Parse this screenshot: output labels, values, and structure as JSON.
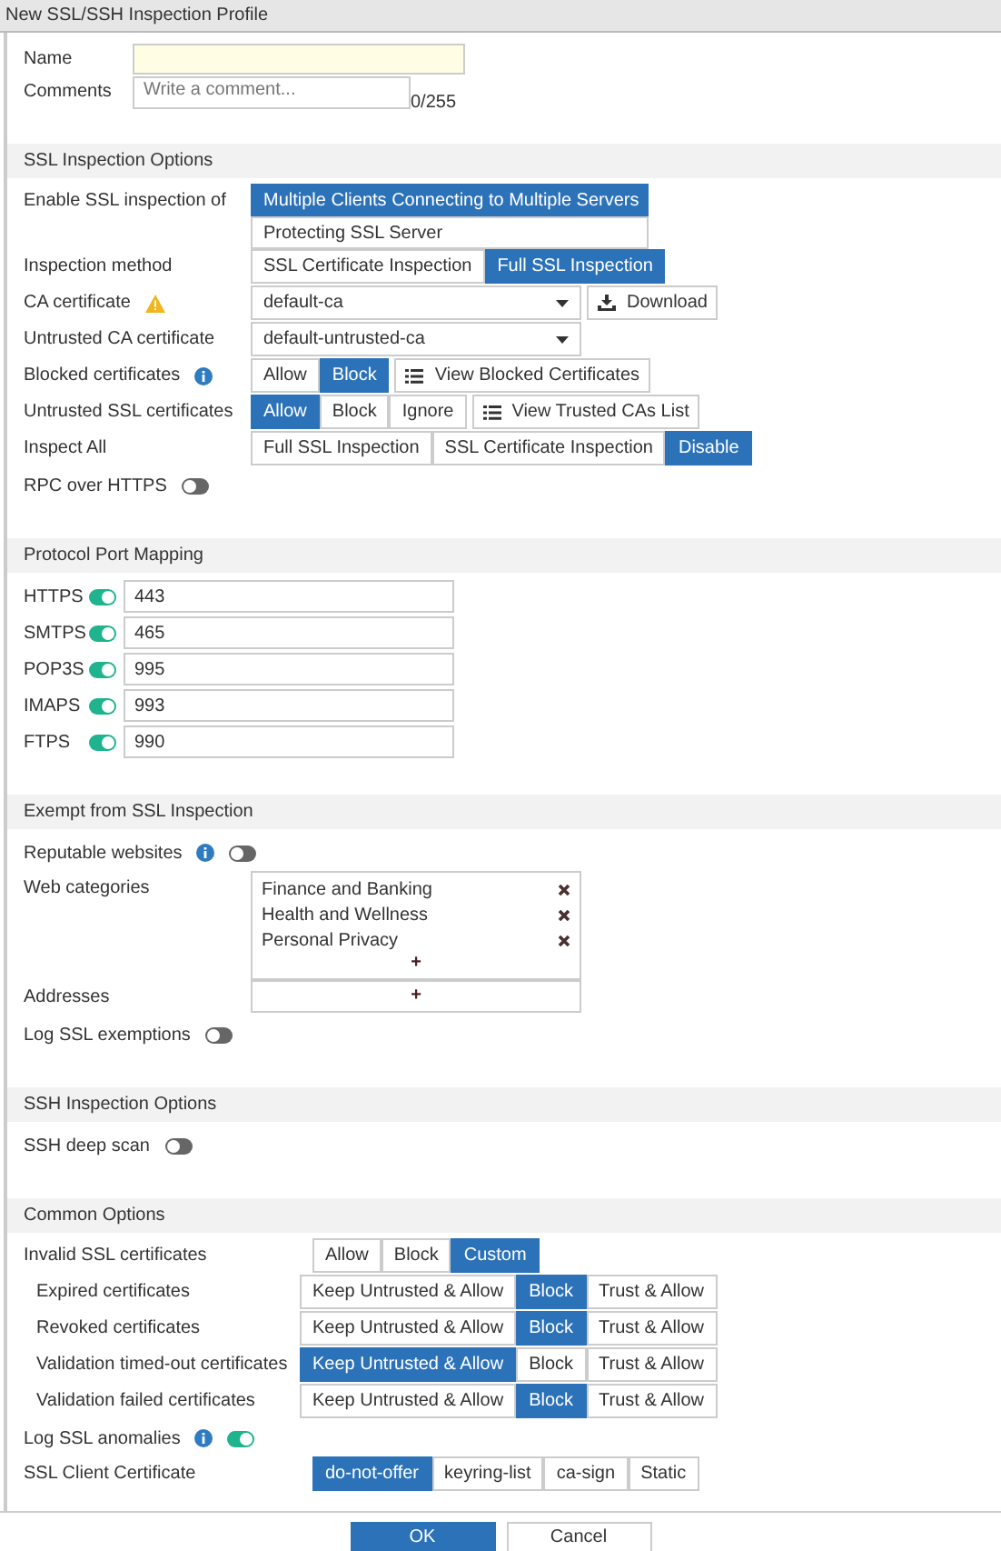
{
  "window": {
    "title": "New SSL/SSH Inspection Profile"
  },
  "name": {
    "label": "Name"
  },
  "comments": {
    "label": "Comments",
    "placeholder": "Write a comment...",
    "counter": "0/255"
  },
  "sections": [
    {
      "title": "SSL Inspection Options",
      "rows": [
        {
          "kind": "stacked",
          "label": "Enable SSL inspection of",
          "options": [
            {
              "label": "Multiple Clients Connecting to Multiple Servers",
              "selected": true
            },
            {
              "label": "Protecting SSL Server",
              "selected": false
            }
          ]
        },
        {
          "kind": "segmented",
          "label": "Inspection method",
          "options": [
            {
              "label": "SSL Certificate Inspection",
              "selected": false
            },
            {
              "label": "Full SSL Inspection",
              "selected": true
            }
          ]
        },
        {
          "kind": "select",
          "label": "CA certificate",
          "warning": true,
          "value": "default-ca",
          "button": {
            "label": "Download",
            "kind": "download"
          }
        },
        {
          "kind": "select",
          "label": "Untrusted CA certificate",
          "value": "default-untrusted-ca"
        },
        {
          "kind": "segmented",
          "label": "Blocked certificates",
          "info": true,
          "options": [
            {
              "label": "Allow",
              "selected": false
            },
            {
              "label": "Block",
              "selected": true
            }
          ],
          "button": {
            "label": "View Blocked Certificates",
            "kind": "list"
          }
        },
        {
          "kind": "segmented",
          "label": "Untrusted SSL certificates",
          "options": [
            {
              "label": "Allow",
              "selected": true
            },
            {
              "label": "Block",
              "selected": false
            },
            {
              "label": "Ignore",
              "selected": false
            }
          ],
          "button": {
            "label": "View Trusted CAs List",
            "kind": "list"
          }
        },
        {
          "kind": "segmented",
          "label": "Inspect All",
          "options": [
            {
              "label": "Full SSL Inspection",
              "selected": false
            },
            {
              "label": "SSL Certificate Inspection",
              "selected": false
            },
            {
              "label": "Disable",
              "selected": true
            }
          ]
        },
        {
          "kind": "toggle",
          "label": "RPC over HTTPS",
          "on": false
        }
      ]
    },
    {
      "title": "Protocol Port Mapping",
      "rows": [
        {
          "kind": "port",
          "label": "HTTPS",
          "on": true,
          "value": "443"
        },
        {
          "kind": "port",
          "label": "SMTPS",
          "on": true,
          "value": "465"
        },
        {
          "kind": "port",
          "label": "POP3S",
          "on": true,
          "value": "995"
        },
        {
          "kind": "port",
          "label": "IMAPS",
          "on": true,
          "value": "993"
        },
        {
          "kind": "port",
          "label": "FTPS",
          "on": true,
          "value": "990"
        }
      ]
    },
    {
      "title": "Exempt from SSL Inspection",
      "rows": [
        {
          "kind": "toggle",
          "label": "Reputable websites",
          "info": true,
          "on": false
        },
        {
          "kind": "list",
          "label": "Web categories",
          "items": [
            "Finance and Banking",
            "Health and Wellness",
            "Personal Privacy"
          ],
          "add": "+"
        },
        {
          "kind": "list",
          "label": "Addresses",
          "add": "+"
        },
        {
          "kind": "toggle",
          "label": "Log SSL exemptions",
          "on": false
        }
      ]
    },
    {
      "title": "SSH Inspection Options",
      "rows": [
        {
          "kind": "toggle",
          "label": "SSH deep scan",
          "on": false
        }
      ]
    },
    {
      "title": "Common Options",
      "rows": [
        {
          "kind": "segmented",
          "label": "Invalid SSL certificates",
          "options": [
            {
              "label": "Allow",
              "selected": false
            },
            {
              "label": "Block",
              "selected": false
            },
            {
              "label": "Custom",
              "selected": true
            }
          ],
          "children": [
            {
              "kind": "segmented",
              "label": "Expired certificates",
              "options": [
                {
                  "label": "Keep Untrusted & Allow",
                  "selected": false
                },
                {
                  "label": "Block",
                  "selected": true
                },
                {
                  "label": "Trust & Allow",
                  "selected": false
                }
              ]
            },
            {
              "kind": "segmented",
              "label": "Revoked certificates",
              "options": [
                {
                  "label": "Keep Untrusted & Allow",
                  "selected": false
                },
                {
                  "label": "Block",
                  "selected": true
                },
                {
                  "label": "Trust & Allow",
                  "selected": false
                }
              ]
            },
            {
              "kind": "segmented",
              "label": "Validation timed-out certificates",
              "options": [
                {
                  "label": "Keep Untrusted & Allow",
                  "selected": true
                },
                {
                  "label": "Block",
                  "selected": false
                },
                {
                  "label": "Trust & Allow",
                  "selected": false
                }
              ]
            },
            {
              "kind": "segmented",
              "label": "Validation failed certificates",
              "options": [
                {
                  "label": "Keep Untrusted & Allow",
                  "selected": false
                },
                {
                  "label": "Block",
                  "selected": true
                },
                {
                  "label": "Trust & Allow",
                  "selected": false
                }
              ]
            }
          ]
        },
        {
          "kind": "toggle",
          "label": "Log SSL anomalies",
          "info": true,
          "on": true
        },
        {
          "kind": "segmented",
          "label": "SSL Client Certificate",
          "options": [
            {
              "label": "do-not-offer",
              "selected": true
            },
            {
              "label": "keyring-list",
              "selected": false
            },
            {
              "label": "ca-sign",
              "selected": false
            },
            {
              "label": "Static",
              "selected": false
            }
          ]
        }
      ]
    }
  ],
  "footer": [
    {
      "label": "OK",
      "kind": "primary"
    },
    {
      "label": "Cancel",
      "kind": "secondary"
    }
  ]
}
